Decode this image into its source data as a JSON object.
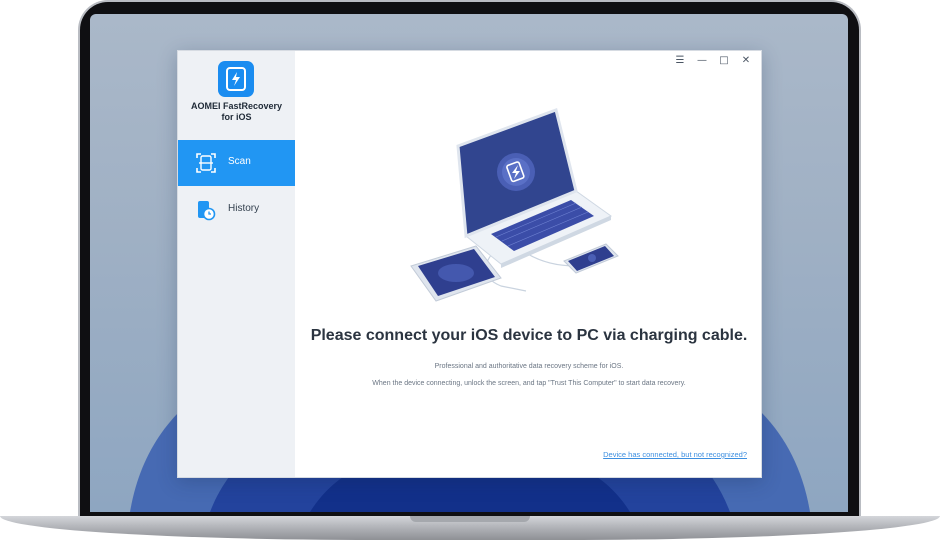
{
  "app": {
    "name_line1": "AOMEI FastRecovery",
    "name_line2": "for iOS",
    "brand_color": "#2196f3"
  },
  "window_controls": {
    "menu": "☰",
    "minimize": "—",
    "maximize": "□",
    "close": "✕"
  },
  "sidebar": {
    "items": [
      {
        "label": "Scan",
        "icon": "scan-icon",
        "active": true
      },
      {
        "label": "History",
        "icon": "history-icon",
        "active": false
      }
    ]
  },
  "main": {
    "headline": "Please connect your iOS device to PC via charging cable.",
    "subtext_line1": "Professional and authoritative data recovery scheme for iOS.",
    "subtext_line2": "When the device connecting, unlock the screen, and tap \"Trust This Computer\" to start data recovery.",
    "help_link": "Device has connected, but not recognized?"
  }
}
